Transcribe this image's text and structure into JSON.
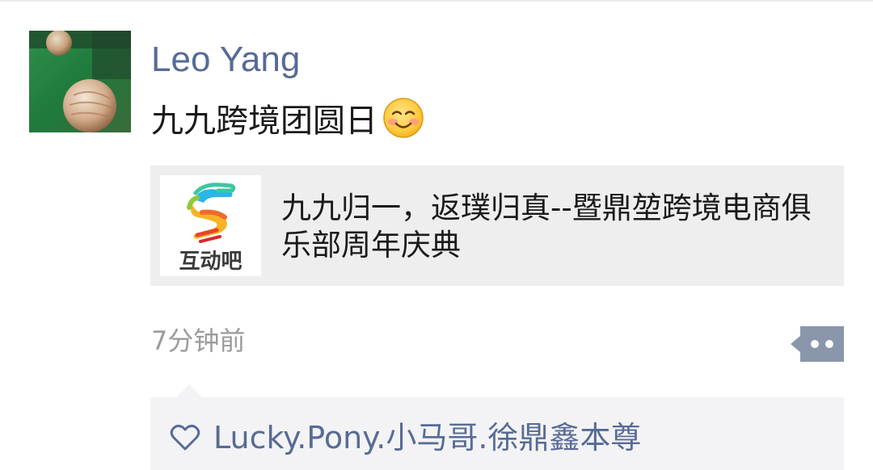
{
  "post": {
    "author": "Leo Yang",
    "text": "九九跨境团圆日",
    "emoji_icon": "smiling-face-icon",
    "share": {
      "thumbnail_label": "互动吧",
      "title": "九九归一，返璞归真--暨鼎堃跨境电商俱乐部周年庆典"
    },
    "timestamp": "7分钟前",
    "likes": {
      "icon": "heart-outline-icon",
      "names": "Lucky.Pony.小马哥.徐鼎鑫本尊"
    }
  },
  "colors": {
    "link": "#576b95",
    "text": "#1a1a1a",
    "muted": "#9b9b9b",
    "card_bg": "#eeeeee",
    "likes_bg": "#f3f3f5",
    "more_button": "#8a96ab"
  }
}
